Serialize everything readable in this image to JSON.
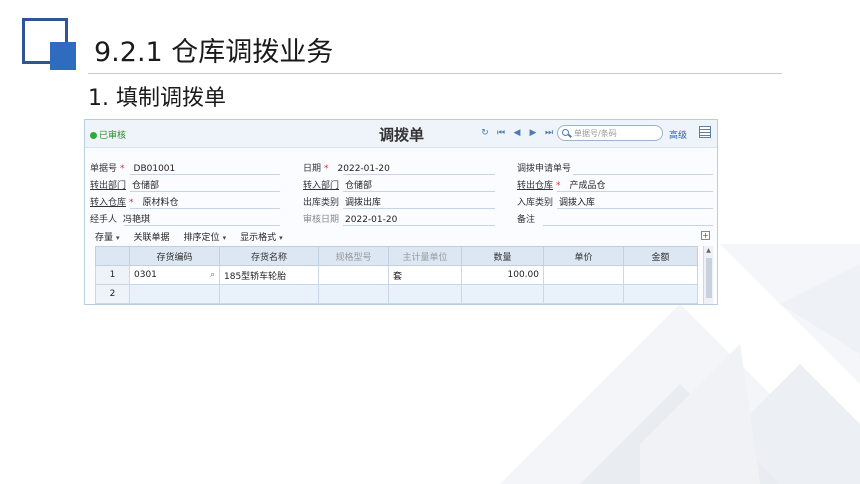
{
  "slide": {
    "title": "9.2.1  仓库调拨业务",
    "subtitle": "1. 填制调拨单"
  },
  "app": {
    "status_text": "已审核",
    "doc_title": "调拨单",
    "nav_icons": [
      "refresh-icon",
      "first-icon",
      "prev-icon",
      "next-icon",
      "last-icon"
    ],
    "search_placeholder": "单据号/条码",
    "advanced_label": "高级",
    "form": {
      "doc_no": {
        "label": "单据号",
        "value": "DB01001"
      },
      "date": {
        "label": "日期",
        "value": "2022-01-20"
      },
      "transfer_request_no": {
        "label": "调拨申请单号",
        "value": ""
      },
      "out_dept": {
        "label": "转出部门",
        "value": "仓储部"
      },
      "in_dept": {
        "label": "转入部门",
        "value": "仓储部"
      },
      "out_warehouse": {
        "label": "转出仓库",
        "value": "产成品仓"
      },
      "in_warehouse": {
        "label": "转入仓库",
        "value": "原材料仓"
      },
      "out_type": {
        "label": "出库类别",
        "value": "调拨出库"
      },
      "in_type": {
        "label": "入库类别",
        "value": "调拨入库"
      },
      "handler": {
        "label": "经手人",
        "value": "冯艳琪"
      },
      "audit_date": {
        "label": "审核日期",
        "value": "2022-01-20"
      },
      "remark": {
        "label": "备注",
        "value": ""
      }
    },
    "table_tools": [
      {
        "label": "存量",
        "caret": "▾"
      },
      {
        "label": "关联单据",
        "caret": ""
      },
      {
        "label": "排序定位",
        "caret": "▾"
      },
      {
        "label": "显示格式",
        "caret": "▾"
      }
    ],
    "columns": [
      "",
      "存货编码",
      "存货名称",
      "规格型号",
      "主计量单位",
      "数量",
      "单价",
      "金额"
    ],
    "rows": [
      {
        "no": "1",
        "code": "0301",
        "name": "185型轿车轮胎",
        "spec": "",
        "unit": "套",
        "qty": "100.00",
        "price": "",
        "amount": ""
      },
      {
        "no": "2",
        "code": "",
        "name": "",
        "spec": "",
        "unit": "",
        "qty": "",
        "price": "",
        "amount": ""
      }
    ]
  },
  "colors": {
    "accent": "#2f6cc0",
    "status_green": "#2eaa3a",
    "required_red": "#dd3333",
    "grid_header": "#dce7f3"
  }
}
